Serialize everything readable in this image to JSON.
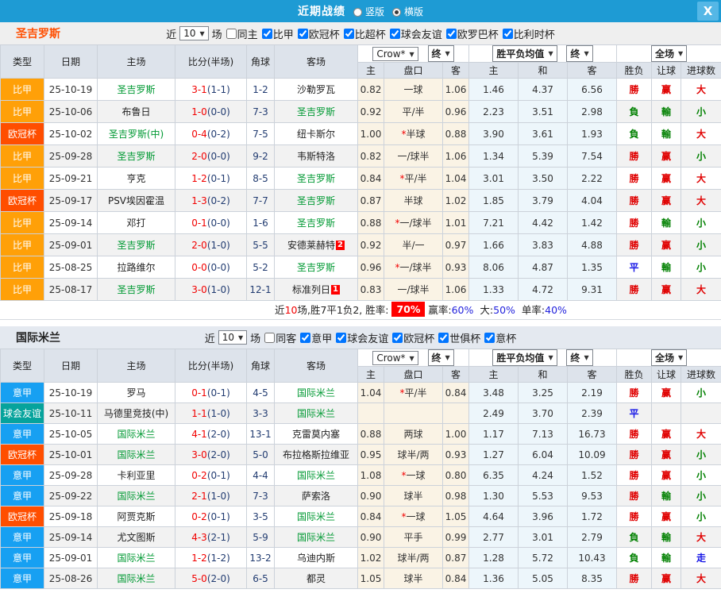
{
  "titlebar": {
    "title": "近期战绩",
    "close_glyph": "X",
    "radios": [
      {
        "label": "竖版",
        "selected": false
      },
      {
        "label": "横版",
        "selected": true
      }
    ]
  },
  "table_header": {
    "type": "类型",
    "date": "日期",
    "home": "主场",
    "score": "比分(半场)",
    "corners": "角球",
    "away": "客场",
    "dd_crow": "Crow*",
    "dd_final1": "终",
    "dd_avg": "胜平负均值",
    "dd_final2": "终",
    "dd_full": "全场",
    "sub": [
      "主",
      "盘口",
      "客",
      "主",
      "和",
      "客",
      "胜负",
      "让球",
      "进球数"
    ]
  },
  "colors": {
    "titlebar_blue": "#1e9bd4",
    "team_green": "#009933",
    "win_red": "#e00000",
    "lose_green": "#008000",
    "draw_blue": "#1414e6",
    "type_colors": {
      "比甲": "#ffa008",
      "欧冠杯": "#ff4e00",
      "意甲": "#17a0f2",
      "球会友谊": "#06a39c"
    }
  },
  "sections": [
    {
      "team": "圣吉罗斯",
      "team_color": "#ff4e00",
      "filter": {
        "near": "近",
        "count": "10",
        "unit": "场",
        "same": {
          "label": "同主",
          "checked": false
        },
        "leagues": [
          {
            "label": "比甲",
            "checked": true
          },
          {
            "label": "欧冠杯",
            "checked": true
          },
          {
            "label": "比超杯",
            "checked": true
          },
          {
            "label": "球会友谊",
            "checked": true
          },
          {
            "label": "欧罗巴杯",
            "checked": true
          },
          {
            "label": "比利时杯",
            "checked": true
          }
        ]
      },
      "rows": [
        {
          "t": "比甲",
          "d": "25-10-19",
          "h": "圣吉罗斯",
          "hg": true,
          "hb": "",
          "s": "3-1",
          "sh": "(1-1)",
          "c": "1-2",
          "a": "沙勒罗瓦",
          "ag": false,
          "ab": "",
          "o1": "0.82",
          "hc": "一球",
          "o2": "1.06",
          "m1": "1.46",
          "m2": "4.37",
          "m3": "6.56",
          "r1": "勝",
          "k1": "r",
          "r2": "赢",
          "k2": "r",
          "r3": "大",
          "k3": "r"
        },
        {
          "t": "比甲",
          "d": "25-10-06",
          "h": "布鲁日",
          "hg": false,
          "hb": "",
          "s": "1-0",
          "sh": "(0-0)",
          "c": "7-3",
          "a": "圣吉罗斯",
          "ag": true,
          "ab": "",
          "o1": "0.92",
          "hc": "平/半",
          "o2": "0.96",
          "m1": "2.23",
          "m2": "3.51",
          "m3": "2.98",
          "r1": "負",
          "k1": "g",
          "r2": "輸",
          "k2": "g",
          "r3": "小",
          "k3": "g"
        },
        {
          "t": "欧冠杯",
          "d": "25-10-02",
          "h": "圣吉罗斯(中)",
          "hg": true,
          "hb": "",
          "s": "0-4",
          "sh": "(0-2)",
          "c": "7-5",
          "a": "纽卡斯尔",
          "ag": false,
          "ab": "",
          "o1": "1.00",
          "hc": "*半球",
          "o2": "0.88",
          "m1": "3.90",
          "m2": "3.61",
          "m3": "1.93",
          "r1": "負",
          "k1": "g",
          "r2": "輸",
          "k2": "g",
          "r3": "大",
          "k3": "r"
        },
        {
          "t": "比甲",
          "d": "25-09-28",
          "h": "圣吉罗斯",
          "hg": true,
          "hb": "",
          "s": "2-0",
          "sh": "(0-0)",
          "c": "9-2",
          "a": "韦斯特洛",
          "ag": false,
          "ab": "",
          "o1": "0.82",
          "hc": "一/球半",
          "o2": "1.06",
          "m1": "1.34",
          "m2": "5.39",
          "m3": "7.54",
          "r1": "勝",
          "k1": "r",
          "r2": "赢",
          "k2": "r",
          "r3": "小",
          "k3": "g"
        },
        {
          "t": "比甲",
          "d": "25-09-21",
          "h": "亨克",
          "hg": false,
          "hb": "",
          "s": "1-2",
          "sh": "(0-1)",
          "c": "8-5",
          "a": "圣吉罗斯",
          "ag": true,
          "ab": "",
          "o1": "0.84",
          "hc": "*平/半",
          "o2": "1.04",
          "m1": "3.01",
          "m2": "3.50",
          "m3": "2.22",
          "r1": "勝",
          "k1": "r",
          "r2": "赢",
          "k2": "r",
          "r3": "大",
          "k3": "r"
        },
        {
          "t": "欧冠杯",
          "d": "25-09-17",
          "h": "PSV埃因霍温",
          "hg": false,
          "hb": "",
          "s": "1-3",
          "sh": "(0-2)",
          "c": "7-7",
          "a": "圣吉罗斯",
          "ag": true,
          "ab": "",
          "o1": "0.87",
          "hc": "半球",
          "o2": "1.02",
          "m1": "1.85",
          "m2": "3.79",
          "m3": "4.04",
          "r1": "勝",
          "k1": "r",
          "r2": "赢",
          "k2": "r",
          "r3": "大",
          "k3": "r"
        },
        {
          "t": "比甲",
          "d": "25-09-14",
          "h": "邓打",
          "hg": false,
          "hb": "",
          "s": "0-1",
          "sh": "(0-0)",
          "c": "1-6",
          "a": "圣吉罗斯",
          "ag": true,
          "ab": "",
          "o1": "0.88",
          "hc": "*一/球半",
          "o2": "1.01",
          "m1": "7.21",
          "m2": "4.42",
          "m3": "1.42",
          "r1": "勝",
          "k1": "r",
          "r2": "輸",
          "k2": "g",
          "r3": "小",
          "k3": "g"
        },
        {
          "t": "比甲",
          "d": "25-09-01",
          "h": "圣吉罗斯",
          "hg": true,
          "hb": "",
          "s": "2-0",
          "sh": "(1-0)",
          "c": "5-5",
          "a": "安德莱赫特",
          "ag": false,
          "ab": "2",
          "o1": "0.92",
          "hc": "半/一",
          "o2": "0.97",
          "m1": "1.66",
          "m2": "3.83",
          "m3": "4.88",
          "r1": "勝",
          "k1": "r",
          "r2": "赢",
          "k2": "r",
          "r3": "小",
          "k3": "g"
        },
        {
          "t": "比甲",
          "d": "25-08-25",
          "h": "拉路维尔",
          "hg": false,
          "hb": "",
          "s": "0-0",
          "sh": "(0-0)",
          "c": "5-2",
          "a": "圣吉罗斯",
          "ag": true,
          "ab": "",
          "o1": "0.96",
          "hc": "*一/球半",
          "o2": "0.93",
          "m1": "8.06",
          "m2": "4.87",
          "m3": "1.35",
          "r1": "平",
          "k1": "b",
          "r2": "輸",
          "k2": "g",
          "r3": "小",
          "k3": "g"
        },
        {
          "t": "比甲",
          "d": "25-08-17",
          "h": "圣吉罗斯",
          "hg": true,
          "hb": "",
          "s": "3-0",
          "sh": "(1-0)",
          "c": "12-1",
          "a": "标准列日",
          "ag": false,
          "ab": "1",
          "o1": "0.83",
          "hc": "一/球半",
          "o2": "1.06",
          "m1": "1.33",
          "m2": "4.72",
          "m3": "9.31",
          "r1": "勝",
          "k1": "r",
          "r2": "赢",
          "k2": "r",
          "r3": "大",
          "k3": "r"
        }
      ],
      "footer": {
        "near": "近",
        "count": "10",
        "after": "场,胜7平1负2, 胜率:",
        "win_rate": "70%",
        "stats": [
          {
            "label": "赢率:",
            "value": "60%"
          },
          {
            "label": "大:",
            "value": "50%"
          },
          {
            "label": "单率:",
            "value": "40%"
          }
        ]
      }
    },
    {
      "team": "国际米兰",
      "team_color": "#222222",
      "filter": {
        "near": "近",
        "count": "10",
        "unit": "场",
        "same": {
          "label": "同客",
          "checked": false
        },
        "leagues": [
          {
            "label": "意甲",
            "checked": true
          },
          {
            "label": "球会友谊",
            "checked": true
          },
          {
            "label": "欧冠杯",
            "checked": true
          },
          {
            "label": "世俱杯",
            "checked": true
          },
          {
            "label": "意杯",
            "checked": true
          }
        ]
      },
      "rows": [
        {
          "t": "意甲",
          "d": "25-10-19",
          "h": "罗马",
          "hg": false,
          "hb": "",
          "s": "0-1",
          "sh": "(0-1)",
          "c": "4-5",
          "a": "国际米兰",
          "ag": true,
          "ab": "",
          "o1": "1.04",
          "hc": "*平/半",
          "o2": "0.84",
          "m1": "3.48",
          "m2": "3.25",
          "m3": "2.19",
          "r1": "勝",
          "k1": "r",
          "r2": "赢",
          "k2": "r",
          "r3": "小",
          "k3": "g"
        },
        {
          "t": "球会友谊",
          "d": "25-10-11",
          "h": "马德里竞技(中)",
          "hg": false,
          "hb": "",
          "s": "1-1",
          "sh": "(1-0)",
          "c": "3-3",
          "a": "国际米兰",
          "ag": true,
          "ab": "",
          "o1": "",
          "hc": "",
          "o2": "",
          "m1": "2.49",
          "m2": "3.70",
          "m3": "2.39",
          "r1": "平",
          "k1": "b",
          "r2": "",
          "k2": "",
          "r3": "",
          "k3": ""
        },
        {
          "t": "意甲",
          "d": "25-10-05",
          "h": "国际米兰",
          "hg": true,
          "hb": "",
          "s": "4-1",
          "sh": "(2-0)",
          "c": "13-1",
          "a": "克雷莫内塞",
          "ag": false,
          "ab": "",
          "o1": "0.88",
          "hc": "两球",
          "o2": "1.00",
          "m1": "1.17",
          "m2": "7.13",
          "m3": "16.73",
          "r1": "勝",
          "k1": "r",
          "r2": "赢",
          "k2": "r",
          "r3": "大",
          "k3": "r"
        },
        {
          "t": "欧冠杯",
          "d": "25-10-01",
          "h": "国际米兰",
          "hg": true,
          "hb": "",
          "s": "3-0",
          "sh": "(2-0)",
          "c": "5-0",
          "a": "布拉格斯拉维亚",
          "ag": false,
          "ab": "",
          "o1": "0.95",
          "hc": "球半/两",
          "o2": "0.93",
          "m1": "1.27",
          "m2": "6.04",
          "m3": "10.09",
          "r1": "勝",
          "k1": "r",
          "r2": "赢",
          "k2": "r",
          "r3": "小",
          "k3": "g"
        },
        {
          "t": "意甲",
          "d": "25-09-28",
          "h": "卡利亚里",
          "hg": false,
          "hb": "",
          "s": "0-2",
          "sh": "(0-1)",
          "c": "4-4",
          "a": "国际米兰",
          "ag": true,
          "ab": "",
          "o1": "1.08",
          "hc": "*一球",
          "o2": "0.80",
          "m1": "6.35",
          "m2": "4.24",
          "m3": "1.52",
          "r1": "勝",
          "k1": "r",
          "r2": "赢",
          "k2": "r",
          "r3": "小",
          "k3": "g"
        },
        {
          "t": "意甲",
          "d": "25-09-22",
          "h": "国际米兰",
          "hg": true,
          "hb": "",
          "s": "2-1",
          "sh": "(1-0)",
          "c": "7-3",
          "a": "萨索洛",
          "ag": false,
          "ab": "",
          "o1": "0.90",
          "hc": "球半",
          "o2": "0.98",
          "m1": "1.30",
          "m2": "5.53",
          "m3": "9.53",
          "r1": "勝",
          "k1": "r",
          "r2": "輸",
          "k2": "g",
          "r3": "小",
          "k3": "g"
        },
        {
          "t": "欧冠杯",
          "d": "25-09-18",
          "h": "阿贾克斯",
          "hg": false,
          "hb": "",
          "s": "0-2",
          "sh": "(0-1)",
          "c": "3-5",
          "a": "国际米兰",
          "ag": true,
          "ab": "",
          "o1": "0.84",
          "hc": "*一球",
          "o2": "1.05",
          "m1": "4.64",
          "m2": "3.96",
          "m3": "1.72",
          "r1": "勝",
          "k1": "r",
          "r2": "赢",
          "k2": "r",
          "r3": "小",
          "k3": "g"
        },
        {
          "t": "意甲",
          "d": "25-09-14",
          "h": "尤文图斯",
          "hg": false,
          "hb": "",
          "s": "4-3",
          "sh": "(2-1)",
          "c": "5-9",
          "a": "国际米兰",
          "ag": true,
          "ab": "",
          "o1": "0.90",
          "hc": "平手",
          "o2": "0.99",
          "m1": "2.77",
          "m2": "3.01",
          "m3": "2.79",
          "r1": "負",
          "k1": "g",
          "r2": "輸",
          "k2": "g",
          "r3": "大",
          "k3": "r"
        },
        {
          "t": "意甲",
          "d": "25-09-01",
          "h": "国际米兰",
          "hg": true,
          "hb": "",
          "s": "1-2",
          "sh": "(1-2)",
          "c": "13-2",
          "a": "乌迪内斯",
          "ag": false,
          "ab": "",
          "o1": "1.02",
          "hc": "球半/两",
          "o2": "0.87",
          "m1": "1.28",
          "m2": "5.72",
          "m3": "10.43",
          "r1": "負",
          "k1": "g",
          "r2": "輸",
          "k2": "g",
          "r3": "走",
          "k3": "b"
        },
        {
          "t": "意甲",
          "d": "25-08-26",
          "h": "国际米兰",
          "hg": true,
          "hb": "",
          "s": "5-0",
          "sh": "(2-0)",
          "c": "6-5",
          "a": "都灵",
          "ag": false,
          "ab": "",
          "o1": "1.05",
          "hc": "球半",
          "o2": "0.84",
          "m1": "1.36",
          "m2": "5.05",
          "m3": "8.35",
          "r1": "勝",
          "k1": "r",
          "r2": "赢",
          "k2": "r",
          "r3": "大",
          "k3": "r"
        }
      ],
      "footer": null
    }
  ]
}
